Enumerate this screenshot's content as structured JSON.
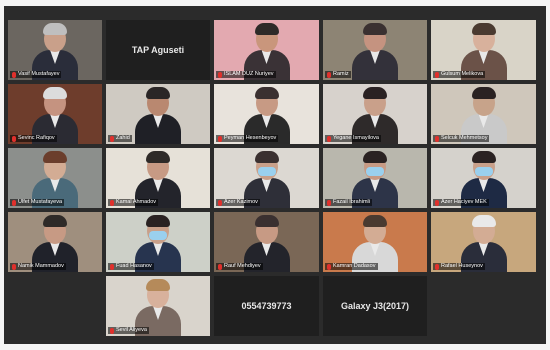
{
  "tiles": [
    {
      "name": "Vasif Mustafayev",
      "bg": "#6b6660",
      "skin": "#c9a08a",
      "hair": "#bfbfbf",
      "suit": "#2a2d3a",
      "mask": false
    },
    {
      "text": "TAP Aguseti",
      "dark": true
    },
    {
      "name": "ISLAM DUZ Nuriyev",
      "bg": "#e3a9b0",
      "skin": "#c9967c",
      "hair": "#2e2a28",
      "suit": "#3a3236",
      "mask": false
    },
    {
      "name": "Ramiz",
      "bg": "#8d8474",
      "skin": "#c59380",
      "hair": "#3a3030",
      "suit": "#33313a",
      "mask": false
    },
    {
      "name": "Gulsum Melikova",
      "bg": "#d9d4c8",
      "skin": "#d8b19c",
      "hair": "#4a3a30",
      "suit": "#6b5248",
      "mask": false
    },
    {
      "name": "Sevinc Rafiqov",
      "bg": "#6e3d2c",
      "skin": "#c59380",
      "hair": "#dcdcdc",
      "suit": "#2b2b33",
      "mask": false
    },
    {
      "name": "Zahid",
      "bg": "#cfcac2",
      "skin": "#b98870",
      "hair": "#2a2626",
      "suit": "#1f2026",
      "mask": false
    },
    {
      "name": "Peyman Hesenbeyov",
      "bg": "#e8e3dc",
      "skin": "#c79a84",
      "hair": "#3a3030",
      "suit": "#2a2a2a",
      "mask": false
    },
    {
      "name": "Yegane Ismayilova",
      "bg": "#d7d2cc",
      "skin": "#c9a08a",
      "hair": "#2a2222",
      "suit": "#2e2a2a",
      "mask": false
    },
    {
      "name": "Selcuk Mehmetsoy",
      "bg": "#cfc7bb",
      "skin": "#c7a38a",
      "hair": "#2a2222",
      "suit": "#c9c9c9",
      "mask": false
    },
    {
      "name": "Ulfet Mustafayeva",
      "bg": "#8c8f8c",
      "skin": "#d3ac94",
      "hair": "#6b3e2c",
      "suit": "#4a6a7a",
      "mask": false
    },
    {
      "name": "Kamal Ahmadov",
      "bg": "#e6e1d8",
      "skin": "#c79a84",
      "hair": "#2e2a28",
      "suit": "#23242b",
      "mask": false
    },
    {
      "name": "Azer Kazimov",
      "bg": "#dcd8d2",
      "skin": "#c9a08a",
      "hair": "#3a3030",
      "suit": "#2e2f38",
      "mask": true
    },
    {
      "name": "Fazail Ibrahimli",
      "bg": "#b9b7ad",
      "skin": "#c79a84",
      "hair": "#2a2222",
      "suit": "#2d3448",
      "mask": true
    },
    {
      "name": "Azer Haciyev MEK",
      "bg": "#d5d2cc",
      "skin": "#c9a08a",
      "hair": "#2a2222",
      "suit": "#1e2a44",
      "mask": true
    },
    {
      "name": "Namik Mammadov",
      "bg": "#9f8f7e",
      "skin": "#c79a84",
      "hair": "#2e2a28",
      "suit": "#20222a",
      "mask": false
    },
    {
      "name": "Fuad Hasanov",
      "bg": "#cdd0c8",
      "skin": "#c9a08a",
      "hair": "#2a2222",
      "suit": "#27344f",
      "mask": true
    },
    {
      "name": "Rauf Mehdiyev",
      "bg": "#7a6756",
      "skin": "#c79a84",
      "hair": "#3a3030",
      "suit": "#23242b",
      "mask": false,
      "active": true
    },
    {
      "name": "Kamran Dadasov",
      "bg": "#c97a4c",
      "skin": "#d3ac94",
      "hair": "#4a3a30",
      "suit": "#d8d8d8",
      "mask": false
    },
    {
      "name": "Rafael Huseynov",
      "bg": "#c7a77d",
      "skin": "#d3ac94",
      "hair": "#e9e9e9",
      "suit": "#2a2d3a",
      "mask": false
    },
    {
      "empty": true
    },
    {
      "name": "Sevil Aliyeva",
      "bg": "#d9d4cc",
      "skin": "#d8b19c",
      "hair": "#b58a5a",
      "suit": "#7a6a62",
      "mask": false
    },
    {
      "text": "0554739773",
      "dark": true
    },
    {
      "text": "Galaxy J3(2017)",
      "dark": true
    },
    {
      "empty": true
    }
  ]
}
